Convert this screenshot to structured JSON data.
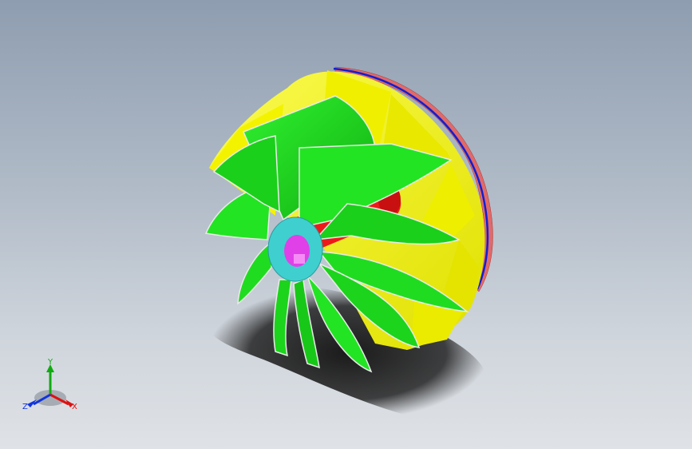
{
  "viewport": {
    "background_top": "#8e9db0",
    "background_bottom": "#dfe2e6"
  },
  "model": {
    "name": "impeller",
    "colors": {
      "blade_green": "#1fe01f",
      "blade_dark": "#0c9a0c",
      "shroud_yellow": "#f0ef00",
      "shroud_light": "#fbfb55",
      "hub_cyan": "#3fcfcf",
      "bore_magenta": "#e040e8",
      "shaft_red": "#ee1a1a",
      "rim_blue": "#1020d0",
      "rim_red": "#e06a6a",
      "shadow": "#2a2a2a"
    }
  },
  "triad": {
    "x_label": "X",
    "y_label": "Y",
    "z_label": "Z",
    "x_color": "#dd1111",
    "y_color": "#11aa11",
    "z_color": "#1133dd"
  }
}
